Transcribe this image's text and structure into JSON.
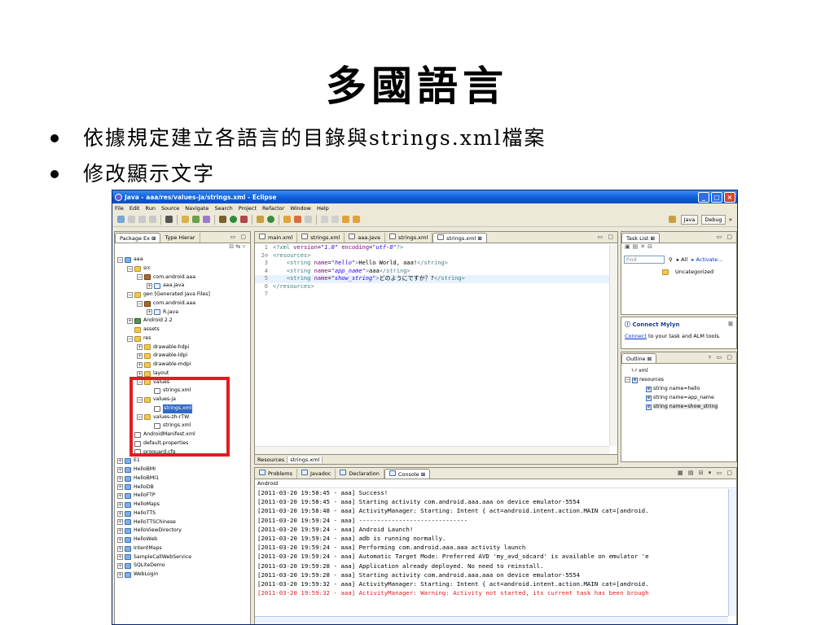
{
  "slide": {
    "title": "多國語言",
    "bullets": [
      "依據規定建立各語言的目錄與strings.xml檔案",
      "修改顯示文字"
    ]
  },
  "window": {
    "title": "Java - aaa/res/values-ja/strings.xml - Eclipse",
    "menu": [
      "File",
      "Edit",
      "Run",
      "Source",
      "Navigate",
      "Search",
      "Project",
      "Refactor",
      "Window",
      "Help"
    ],
    "perspectives": [
      "Java",
      "Debug"
    ]
  },
  "package_explorer": {
    "tabs": [
      "Package Ex",
      "Type Hierar"
    ],
    "rows": [
      {
        "indent": 0,
        "exp": "⊟",
        "icon": "proj",
        "label": "aaa"
      },
      {
        "indent": 1,
        "exp": "⊟",
        "icon": "folder",
        "label": "src"
      },
      {
        "indent": 2,
        "exp": "⊟",
        "icon": "pkg",
        "label": "com.android.aaa"
      },
      {
        "indent": 3,
        "exp": "⊞",
        "icon": "java",
        "label": "aaa.java"
      },
      {
        "indent": 1,
        "exp": "⊟",
        "icon": "folder",
        "label": "gen [Generated Java Files]"
      },
      {
        "indent": 2,
        "exp": "⊟",
        "icon": "pkg",
        "label": "com.android.aaa"
      },
      {
        "indent": 3,
        "exp": "⊞",
        "icon": "java",
        "label": "R.java"
      },
      {
        "indent": 1,
        "exp": "⊞",
        "icon": "lib",
        "label": "Android 2.2"
      },
      {
        "indent": 1,
        "exp": "",
        "icon": "folder",
        "label": "assets"
      },
      {
        "indent": 1,
        "exp": "⊟",
        "icon": "folder",
        "label": "res"
      },
      {
        "indent": 2,
        "exp": "⊞",
        "icon": "folder",
        "label": "drawable-hdpi"
      },
      {
        "indent": 2,
        "exp": "⊞",
        "icon": "folder",
        "label": "drawable-ldpi"
      },
      {
        "indent": 2,
        "exp": "⊞",
        "icon": "folder",
        "label": "drawable-mdpi"
      },
      {
        "indent": 2,
        "exp": "⊞",
        "icon": "folder",
        "label": "layout"
      },
      {
        "indent": 2,
        "exp": "⊟",
        "icon": "folder",
        "label": "values"
      },
      {
        "indent": 3,
        "exp": "",
        "icon": "file",
        "label": "strings.xml"
      },
      {
        "indent": 2,
        "exp": "⊟",
        "icon": "folder",
        "label": "values-ja"
      },
      {
        "indent": 3,
        "exp": "",
        "icon": "file",
        "label": "strings.xml",
        "selected": true
      },
      {
        "indent": 2,
        "exp": "⊟",
        "icon": "folder",
        "label": "values-zh-rTW"
      },
      {
        "indent": 3,
        "exp": "",
        "icon": "file",
        "label": "strings.xml"
      },
      {
        "indent": 1,
        "exp": "",
        "icon": "file",
        "label": "AndroidManifest.xml"
      },
      {
        "indent": 1,
        "exp": "",
        "icon": "file",
        "label": "default.properties"
      },
      {
        "indent": 1,
        "exp": "",
        "icon": "file",
        "label": "proguard.cfg"
      },
      {
        "indent": 0,
        "exp": "⊞",
        "icon": "proj",
        "label": "E1"
      },
      {
        "indent": 0,
        "exp": "⊞",
        "icon": "proj",
        "label": "HelloBMI"
      },
      {
        "indent": 0,
        "exp": "⊞",
        "icon": "proj",
        "label": "HelloBMI1"
      },
      {
        "indent": 0,
        "exp": "⊞",
        "icon": "proj",
        "label": "HelloDB"
      },
      {
        "indent": 0,
        "exp": "⊞",
        "icon": "proj",
        "label": "HelloFTP"
      },
      {
        "indent": 0,
        "exp": "⊞",
        "icon": "proj",
        "label": "HelloMaps"
      },
      {
        "indent": 0,
        "exp": "⊞",
        "icon": "proj",
        "label": "HelloTTS"
      },
      {
        "indent": 0,
        "exp": "⊞",
        "icon": "proj",
        "label": "HelloTTSChinese"
      },
      {
        "indent": 0,
        "exp": "⊞",
        "icon": "proj",
        "label": "HelloViewDirectory"
      },
      {
        "indent": 0,
        "exp": "⊞",
        "icon": "proj",
        "label": "HelloWeb"
      },
      {
        "indent": 0,
        "exp": "⊞",
        "icon": "proj",
        "label": "IntentMaps"
      },
      {
        "indent": 0,
        "exp": "⊞",
        "icon": "proj",
        "label": "SampleCallWebService"
      },
      {
        "indent": 0,
        "exp": "⊞",
        "icon": "proj",
        "label": "SQLiteDemo"
      },
      {
        "indent": 0,
        "exp": "⊞",
        "icon": "proj",
        "label": "WebLogin"
      }
    ]
  },
  "editor": {
    "tabs": [
      "main.xml",
      "strings.xml",
      "aaa.java",
      "strings.xml",
      "strings.xml"
    ],
    "active_tab": 4,
    "bottom_tabs": [
      "Resources",
      "strings.xml"
    ],
    "lines": [
      {
        "n": "1",
        "parts": [
          [
            "pi",
            "<?xml "
          ],
          [
            "attr",
            "version"
          ],
          [
            "plain",
            "="
          ],
          [
            "val",
            "\"1.0\""
          ],
          [
            "plain",
            " "
          ],
          [
            "attr",
            "encoding"
          ],
          [
            "plain",
            "="
          ],
          [
            "val",
            "\"utf-8\""
          ],
          [
            "pi",
            "?>"
          ]
        ]
      },
      {
        "n": "2⊖",
        "parts": [
          [
            "tag",
            "<resources>"
          ]
        ]
      },
      {
        "n": "3",
        "parts": [
          [
            "plain",
            "    "
          ],
          [
            "tag",
            "<string "
          ],
          [
            "attr",
            "name"
          ],
          [
            "plain",
            "="
          ],
          [
            "val",
            "\"hello\""
          ],
          [
            "tag",
            ">"
          ],
          [
            "plain",
            "Hello World, aaa!"
          ],
          [
            "tag",
            "</string>"
          ]
        ]
      },
      {
        "n": "4",
        "parts": [
          [
            "plain",
            "    "
          ],
          [
            "tag",
            "<string "
          ],
          [
            "attr",
            "name"
          ],
          [
            "plain",
            "="
          ],
          [
            "val",
            "\"app_name\""
          ],
          [
            "tag",
            ">"
          ],
          [
            "plain",
            "aaa"
          ],
          [
            "tag",
            "</string>"
          ]
        ]
      },
      {
        "n": "5",
        "parts": [
          [
            "plain",
            "    "
          ],
          [
            "tag",
            "<string "
          ],
          [
            "attr",
            "name"
          ],
          [
            "plain",
            "="
          ],
          [
            "val",
            "\"show_string\""
          ],
          [
            "tag",
            ">"
          ],
          [
            "plain",
            "どのようにですか？?"
          ],
          [
            "tag",
            "</string>"
          ]
        ],
        "hl": true
      },
      {
        "n": "6",
        "parts": [
          [
            "tag",
            "</resources>"
          ]
        ]
      },
      {
        "n": "7",
        "parts": []
      }
    ]
  },
  "task_list": {
    "tab": "Task List",
    "find_placeholder": "Find",
    "all_label": "All",
    "activate_label": "Activate...",
    "uncategorized": "Uncategorized"
  },
  "mylyn": {
    "title": "Connect Mylyn",
    "link": "Connect",
    "text": " to your task and ALM tools."
  },
  "outline": {
    "tab": "Outline",
    "rows": [
      {
        "indent": 0,
        "icon": "?-?",
        "label": "xml"
      },
      {
        "indent": 0,
        "icon": "e",
        "label": "resources",
        "exp": "⊟"
      },
      {
        "indent": 1,
        "icon": "e",
        "label": "string name=hello"
      },
      {
        "indent": 1,
        "icon": "e",
        "label": "string name=app_name"
      },
      {
        "indent": 1,
        "icon": "e",
        "label": "string name=show_string",
        "selected": true
      }
    ]
  },
  "console": {
    "tabs": [
      "Problems",
      "Javadoc",
      "Declaration",
      "Console"
    ],
    "active_tab": 3,
    "label": "Android",
    "lines": [
      {
        "text": "[2011-03-20 19:58:45 - aaa] Success!"
      },
      {
        "text": "[2011-03-20 19:58:45 - aaa] Starting activity com.android.aaa.aaa on device emulator-5554"
      },
      {
        "text": "[2011-03-20 19:58:48 - aaa] ActivityManager: Starting: Intent { act=android.intent.action.MAIN cat=[android."
      },
      {
        "text": "[2011-03-20 19:59:24 - aaa] ------------------------------"
      },
      {
        "text": "[2011-03-20 19:59:24 - aaa] Android Launch!"
      },
      {
        "text": "[2011-03-20 19:59:24 - aaa] adb is running normally."
      },
      {
        "text": "[2011-03-20 19:59:24 - aaa] Performing com.android.aaa.aaa activity launch"
      },
      {
        "text": "[2011-03-20 19:59:24 - aaa] Automatic Target Mode: Preferred AVD 'my_avd_sdcard' is available on emulator 'e"
      },
      {
        "text": "[2011-03-20 19:59:28 - aaa] Application already deployed. No need to reinstall."
      },
      {
        "text": "[2011-03-20 19:59:28 - aaa] Starting activity com.android.aaa.aaa on device emulator-5554"
      },
      {
        "text": "[2011-03-20 19:59:32 - aaa] ActivityManager: Starting: Intent { act=android.intent.action.MAIN cat=[android."
      },
      {
        "text": "[2011-03-20 19:59:32 - aaa] ActivityManager: Warning: Activity not started, its current task has been brough",
        "error": true
      }
    ]
  },
  "colors": {
    "titlebar": "#0a5ad6",
    "highlight_box": "#e31b23",
    "selection": "#316ac5",
    "console_error": "#e31b23"
  }
}
